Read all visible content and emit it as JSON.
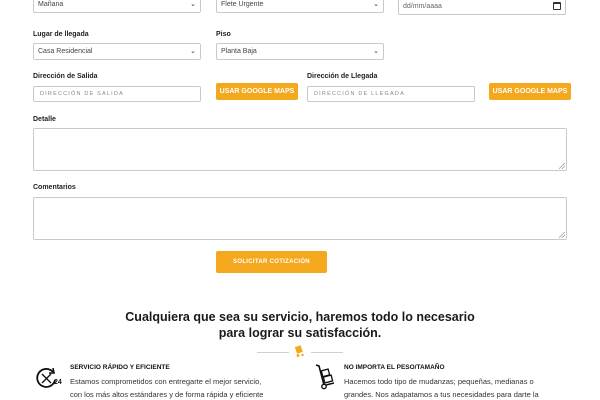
{
  "row1": {
    "hora": "Mañana",
    "servicio": "Flete Urgente",
    "fecha_placeholder": "dd/mm/aaaa"
  },
  "lugar": {
    "label": "Lugar de llegada",
    "value": "Casa Residencial"
  },
  "piso": {
    "label": "Piso",
    "value": "Planta Baja"
  },
  "salida": {
    "label": "Dirección de Salida",
    "placeholder": "DIRECCIÓN DE SALIDA",
    "maps_button": "USAR GOOGLE MAPS"
  },
  "llegada": {
    "label": "Dirección de Llegada",
    "placeholder": "DIRECCIÓN DE LLEGADA",
    "maps_button": "USAR GOOGLE MAPS"
  },
  "detalle": {
    "label": "Detalle"
  },
  "comentarios": {
    "label": "Comentarios"
  },
  "submit": {
    "label": "SOLICITAR COTIZACIÓN"
  },
  "headline": {
    "line1": "Cualquiera que sea su servicio, haremos todo lo necesario",
    "line2": "para lograr su satisfacción."
  },
  "features": [
    {
      "title": "SERVICIO RÁPIDO Y EFICIENTE",
      "line1": "Estamos comprometidos con entregarte el mejor servicio,",
      "line2": "con los más altos estándares y de forma rápida y eficiente",
      "icon": "clock-24-icon"
    },
    {
      "title": "NO IMPORTA EL PESO/TAMAÑO",
      "line1": "Hacemos todo tipo de mudanzas; pequeñas, medianas o",
      "line2": "grandes. Nos adapatamos a tus necesidades para darte la",
      "icon": "hand-truck-icon"
    }
  ],
  "colors": {
    "accent": "#f4a81d"
  }
}
